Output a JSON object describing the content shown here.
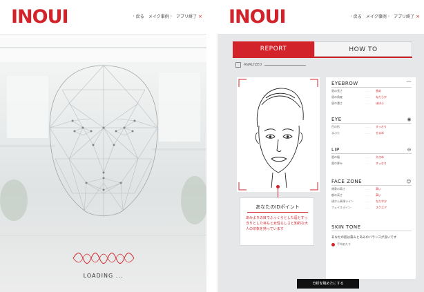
{
  "app": {
    "logo": "INOUI",
    "brand_color": "#d2232a"
  },
  "nav": {
    "back": "戻る",
    "examples": "メイク事例",
    "exit": "アプリ終了",
    "chevron_icon": "chevron-right-icon",
    "close_icon": "close-icon"
  },
  "loading_screen": {
    "status": "LOADING ..."
  },
  "report_screen": {
    "tabs": [
      {
        "label": "REPORT",
        "active": true
      },
      {
        "label": "HOW TO",
        "active": false
      }
    ],
    "analyzed_label": "ANALYZED",
    "point_box": {
      "title": "あなたのIDポイント",
      "text": "あみよりの目でふっくらとした唇とすっきりとした目もと女性らしさと知的な大人の印象を持っています"
    },
    "sections": [
      {
        "title": "EYEBROW",
        "icon": "eyebrow-icon",
        "rows": [
          {
            "label": "眉の長さ",
            "value": "長め"
          },
          {
            "label": "眉の角度",
            "value": "なだらか"
          },
          {
            "label": "眉の濃さ",
            "value": "ほぼふ"
          }
        ]
      },
      {
        "title": "EYE",
        "icon": "eye-icon",
        "rows": [
          {
            "label": "目の形",
            "value": "すっきり"
          },
          {
            "label": "まぶた",
            "value": "せまめ"
          }
        ]
      },
      {
        "title": "LIP",
        "icon": "lip-icon",
        "rows": [
          {
            "label": "唇の幅",
            "value": "大きめ"
          },
          {
            "label": "唇の厚み",
            "value": "すっきり"
          }
        ]
      },
      {
        "title": "FACE ZONE",
        "icon": "face-icon",
        "rows": [
          {
            "label": "頬骨の高さ",
            "value": "高い"
          },
          {
            "label": "額の高さ",
            "value": "高い"
          },
          {
            "label": "顔から鼻頭ライン",
            "value": "なだやか"
          },
          {
            "label": "フェイスライン",
            "value": "スクエア"
          }
        ]
      },
      {
        "title": "SKIN TONE",
        "icon": "",
        "text": "あなたの肌は黄みとあみのバランスが良いです",
        "legend": "平均あたり"
      }
    ],
    "cta_label": "分析を眺めたにする"
  }
}
